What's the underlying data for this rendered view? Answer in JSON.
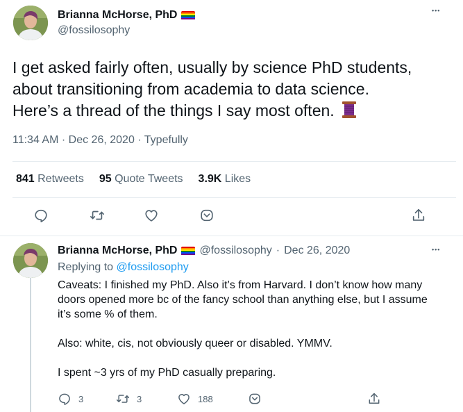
{
  "main_tweet": {
    "author_name": "Brianna McHorse, PhD",
    "handle": "@fossilosophy",
    "more_label": "•••",
    "text_line_1": "I get asked fairly often, usually by science PhD students,",
    "text_line_2": "about transitioning from academia to data science.",
    "text_line_3": "Here’s a thread of the things I say most often.",
    "time": "11:34 AM",
    "date": "Dec 26, 2020",
    "source": "Typefully",
    "retweets_count": "841",
    "retweets_label": "Retweets",
    "quotes_count": "95",
    "quotes_label": "Quote Tweets",
    "likes_count": "3.9K",
    "likes_label": "Likes"
  },
  "reply_tweet": {
    "author_name": "Brianna McHorse, PhD",
    "handle": "@fossilosophy",
    "date": "Dec 26, 2020",
    "more_label": "•••",
    "replying_prefix": "Replying to",
    "replying_to": "@fossilosophy",
    "body_line_1": "Caveats: I finished my PhD. Also it’s from Harvard. I don’t know how many",
    "body_line_2": "doors opened more bc of the fancy school than anything else, but I assume",
    "body_line_3": "it’s some % of them.",
    "body_line_4": "Also: white, cis, not obviously queer or disabled. YMMV.",
    "body_line_5": "I spent ~3 yrs of my PhD casually preparing.",
    "reply_count": "3",
    "retweet_count": "3",
    "like_count": "188"
  },
  "colors": {
    "text": "#0f1419",
    "secondary": "#536471",
    "link": "#1d9bf0",
    "divider": "#e6ecf0"
  },
  "icons": [
    "reply-icon",
    "retweet-icon",
    "like-icon",
    "share-icon",
    "upload-icon",
    "rainbow-flag-icon",
    "spool-of-thread-icon"
  ]
}
